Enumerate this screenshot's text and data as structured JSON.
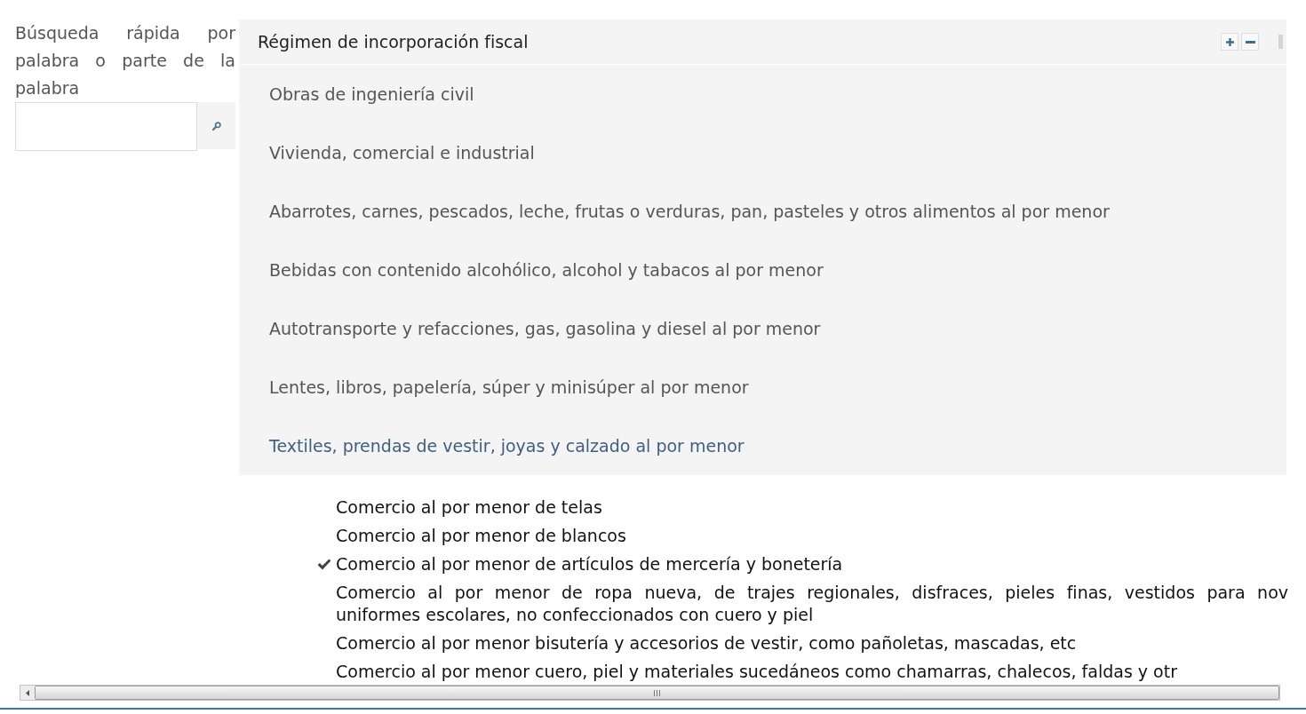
{
  "search": {
    "label": "Búsqueda rápida por palabra o parte de la palabra"
  },
  "panel": {
    "title": "Régimen de incorporación fiscal",
    "items": [
      {
        "label": "Obras de ingeniería civil",
        "selected": false
      },
      {
        "label": "Vivienda, comercial e industrial",
        "selected": false
      },
      {
        "label": "Abarrotes, carnes, pescados, leche, frutas o verduras, pan, pasteles y otros alimentos al por menor",
        "selected": false
      },
      {
        "label": "Bebidas con contenido alcohólico, alcohol y tabacos al por menor",
        "selected": false
      },
      {
        "label": "Autotransporte y refacciones, gas, gasolina y diesel al por menor",
        "selected": false
      },
      {
        "label": "Lentes, libros, papelería, súper y minisúper al por menor",
        "selected": false
      },
      {
        "label": "Textiles, prendas de vestir, joyas y calzado al por menor",
        "selected": true,
        "children": [
          {
            "label": "Comercio al por menor de telas",
            "checked": false
          },
          {
            "label": "Comercio al por menor de blancos",
            "checked": false
          },
          {
            "label": "Comercio al por menor de artículos de mercería y bonetería",
            "checked": true
          },
          {
            "label": "Comercio al por menor de ropa nueva, de trajes regionales, disfraces, pieles finas, vestidos para nov\nuniformes escolares, no confeccionados con cuero y piel",
            "checked": false
          },
          {
            "label": "Comercio al por menor bisutería y accesorios de vestir, como pañoletas, mascadas, etc",
            "checked": false
          },
          {
            "label": "Comercio al por menor cuero, piel y materiales sucedáneos como chamarras, chalecos, faldas y otr",
            "checked": false
          }
        ]
      }
    ]
  }
}
